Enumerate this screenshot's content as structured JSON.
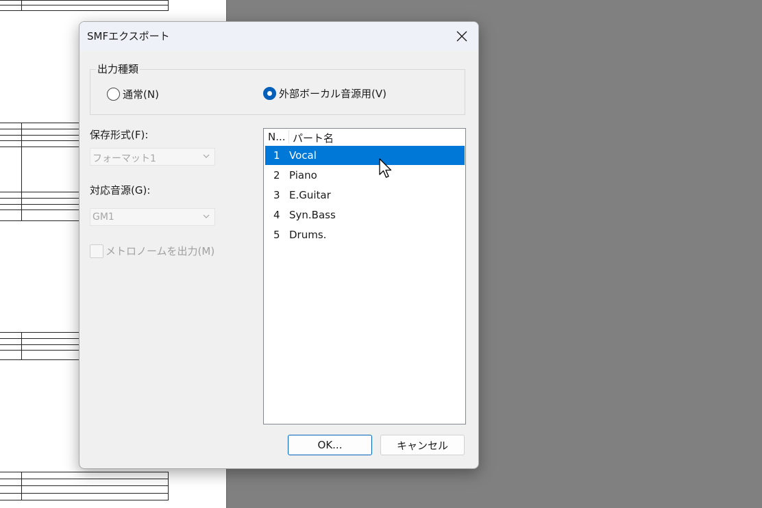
{
  "window": {
    "title": "SMFエクスポート"
  },
  "output_type": {
    "label": "出力種類",
    "options": [
      {
        "label": "通常(N)",
        "selected": false
      },
      {
        "label": "外部ボーカル音源用(V)",
        "selected": true
      }
    ]
  },
  "save_format": {
    "label": "保存形式(F):",
    "value": "フォーマット1"
  },
  "sound_source": {
    "label": "対応音源(G):",
    "value": "GM1"
  },
  "metronome": {
    "label": "メトロノームを出力(M)",
    "checked": false
  },
  "parts": {
    "columns": [
      "N...",
      "パート名"
    ],
    "rows": [
      {
        "num": "1",
        "name": "Vocal",
        "selected": true
      },
      {
        "num": "2",
        "name": "Piano"
      },
      {
        "num": "3",
        "name": "E.Guitar"
      },
      {
        "num": "4",
        "name": "Syn.Bass"
      },
      {
        "num": "5",
        "name": "Drums."
      }
    ]
  },
  "buttons": {
    "ok": "OK...",
    "cancel": "キャンセル"
  },
  "icons": {
    "close": "close-icon",
    "dropdown": "chevron-down-icon",
    "cursor": "mouse-pointer-icon"
  },
  "colors": {
    "accent": "#005fb8",
    "selection": "#0078d7",
    "dialog_bg": "#f0f0f0",
    "desktop_bg": "#808080"
  }
}
